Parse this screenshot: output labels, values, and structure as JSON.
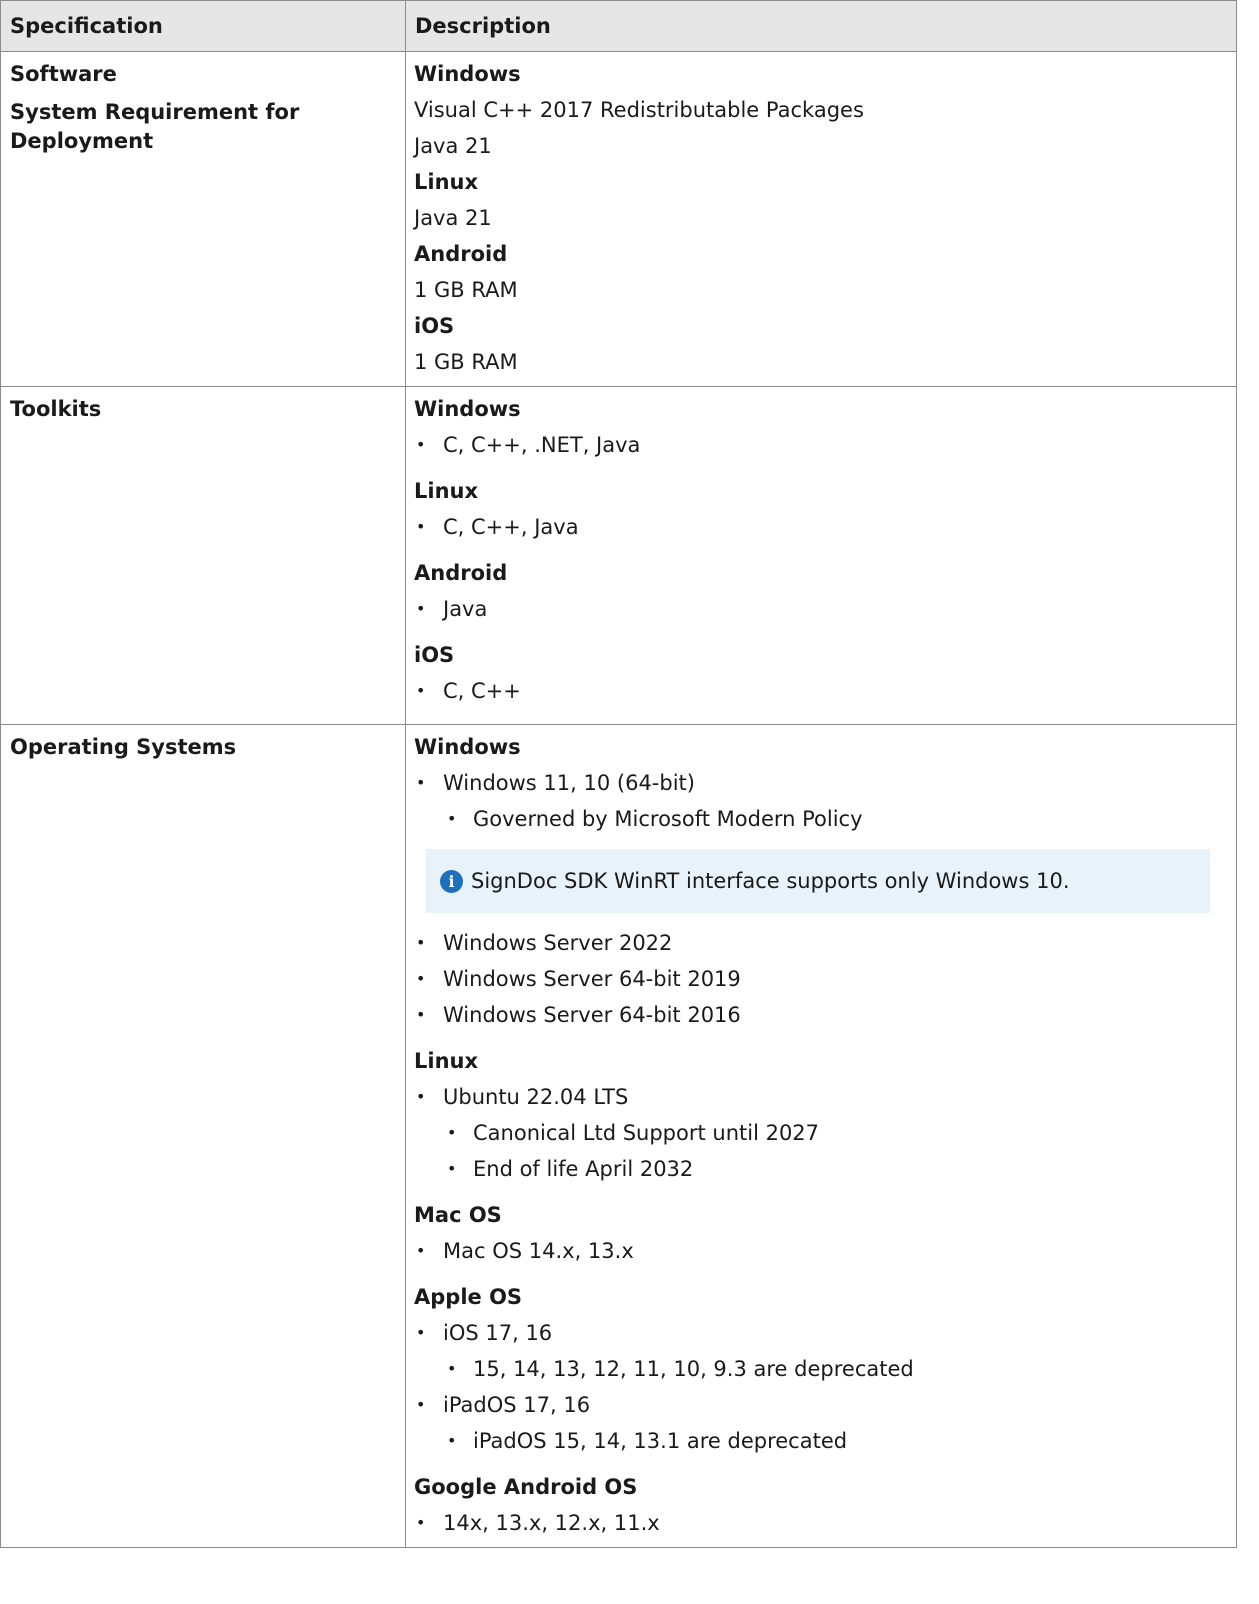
{
  "header": {
    "col1": "Specification",
    "col2": "Description"
  },
  "rows": [
    {
      "label_1": "Software",
      "label_2": "System Requirement for Deployment",
      "windows_heading": "Windows",
      "windows_items": [
        "Visual C++ 2017 Redistributable Packages",
        "Java 21"
      ],
      "linux_heading": "Linux",
      "linux_items": [
        "Java 21"
      ],
      "android_heading": "Android",
      "android_items": [
        "1 GB RAM"
      ],
      "ios_heading": "iOS",
      "ios_items": [
        "1 GB RAM"
      ]
    },
    {
      "label": "Toolkits",
      "windows_heading": "Windows",
      "windows_items": [
        "C, C++, .NET, Java"
      ],
      "linux_heading": "Linux",
      "linux_items": [
        "C, C++, Java"
      ],
      "android_heading": "Android",
      "android_items": [
        "Java"
      ],
      "ios_heading": "iOS",
      "ios_items": [
        "C, C++"
      ]
    },
    {
      "label": "Operating Systems",
      "windows_heading": "Windows",
      "windows_item": "Windows 11, 10 (64-bit)",
      "windows_subitem": "Governed by Microsoft Modern Policy",
      "note_text": "SignDoc SDK WinRT interface supports only Windows 10.",
      "windows_server_items": [
        "Windows Server 2022",
        "Windows Server 64-bit 2019",
        "Windows Server 64-bit 2016"
      ],
      "linux_heading": "Linux",
      "linux_item": "Ubuntu 22.04 LTS",
      "linux_subitems": [
        "Canonical Ltd Support until 2027",
        "End of life April 2032"
      ],
      "macos_heading": "Mac OS",
      "macos_item": "Mac OS 14.x, 13.x",
      "apple_heading": "Apple OS",
      "apple_ios_item": "iOS 17, 16",
      "apple_ios_subitem": "15, 14, 13, 12, 11, 10, 9.3 are deprecated",
      "apple_ipados_item": "iPadOS 17, 16",
      "apple_ipados_subitem": "iPadOS 15, 14, 13.1 are deprecated",
      "android_heading": "Google Android OS",
      "android_item": "14x, 13.x, 12.x, 11.x"
    }
  ],
  "icons": {
    "note_icon": "info-icon"
  },
  "colors": {
    "header_bg": "#e6e6e6",
    "note_bg": "#e7f2fa",
    "info_icon": "#1f6fbf",
    "border": "#8c8c8c"
  }
}
